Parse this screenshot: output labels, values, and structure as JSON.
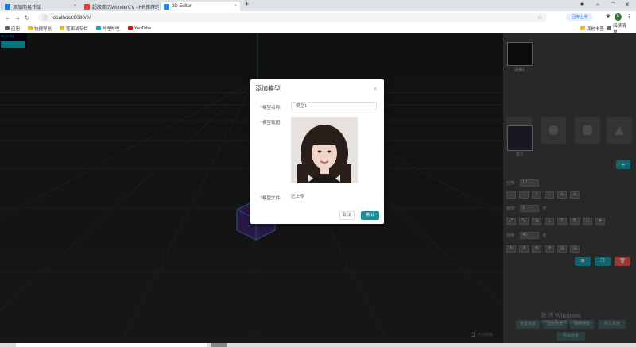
{
  "browser": {
    "tabs": [
      {
        "label": "添加简易作品",
        "color": "#1a73e8"
      },
      {
        "label": "超级简历WonderCV - HR推荐的",
        "color": "#e53935"
      },
      {
        "label": "3D Editor",
        "color": "#1e88e5"
      }
    ],
    "new_tab": "+",
    "close": "×",
    "url": "localhost:8080/#/",
    "sync_badge": "回传上传",
    "avatar_letter": "k"
  },
  "bookmarks": {
    "items": [
      {
        "label": "应用",
        "color": "#5f6368"
      },
      {
        "label": "快捷导航",
        "color": "#f4b400"
      },
      {
        "label": "笔面试专栏",
        "color": "#f4b400"
      },
      {
        "label": "哔哩哔哩",
        "color": "#00a1d6"
      },
      {
        "label": "YouTube",
        "color": "#ff0000"
      }
    ],
    "other": "其他书签",
    "reading_list": "阅读清单"
  },
  "stats": {
    "text": "60 (0-63)"
  },
  "sidebar": {
    "scene_caption": "场景1",
    "texture_caption": "盒子",
    "fields": {
      "step_label": "位移:",
      "step_value": "10",
      "scale_label": "缩放:",
      "scale_value": "2",
      "scale_unit": "倍",
      "rotate_label": "旋转:",
      "rotate_value": "45",
      "rotate_unit": "度"
    },
    "arrows": [
      "←",
      "→",
      "↑",
      "↓",
      "×",
      "×"
    ],
    "bottom": {
      "btn1": "重置场景",
      "btn2": "清空场景",
      "btn3": "保存场景",
      "btn4": "导出场景"
    },
    "watermark": "激活 Windows",
    "watermark_sub": "转到\"设置\"以激活 Windows。",
    "colors": {
      "teal": "#1b8e9a",
      "red": "#d9534f"
    }
  },
  "viewport": {
    "grid_label": "开启网格"
  },
  "modal": {
    "title": "添加模型",
    "close": "×",
    "name_label": "模型名称:",
    "name_value": "模型1",
    "cover_label": "模型截图:",
    "file_label": "模型文件:",
    "file_status": "已上传",
    "required": "*",
    "cancel": "取 消",
    "confirm": "确 认"
  }
}
